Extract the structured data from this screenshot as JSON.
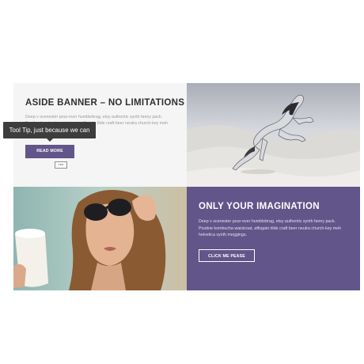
{
  "tooltip": {
    "text": "Tool Tip, just because we can"
  },
  "aside_banner": {
    "title": "ASIDE BANNER – NO LIMITATIONS",
    "description": "Deep v scenester pour-over humblebrag, etsy authentic synth fanny pack. Poutine kombucha waistcoat, affogato tilde craft beer neutra church-key meh helvetica synth meggings.",
    "button_label": "READ MORE",
    "link_tag": "Link"
  },
  "imagination": {
    "title": "ONLY YOUR IMAGINATION",
    "description": "Deep v scenester pour-over humblebrag, etsy authentic synth fanny pack. Poutine kombucha waistcoat, affogato tilde craft beer neutra church-key meh helvetica synth meggings.",
    "button_label": "CLICK ME PEASE"
  },
  "images": {
    "horse": "horse-photo",
    "woman": "woman-with-sunglasses-photo"
  },
  "colors": {
    "accent": "#62558a",
    "panel_light": "#f5f5f5",
    "tooltip_bg": "#3d3d3d"
  }
}
